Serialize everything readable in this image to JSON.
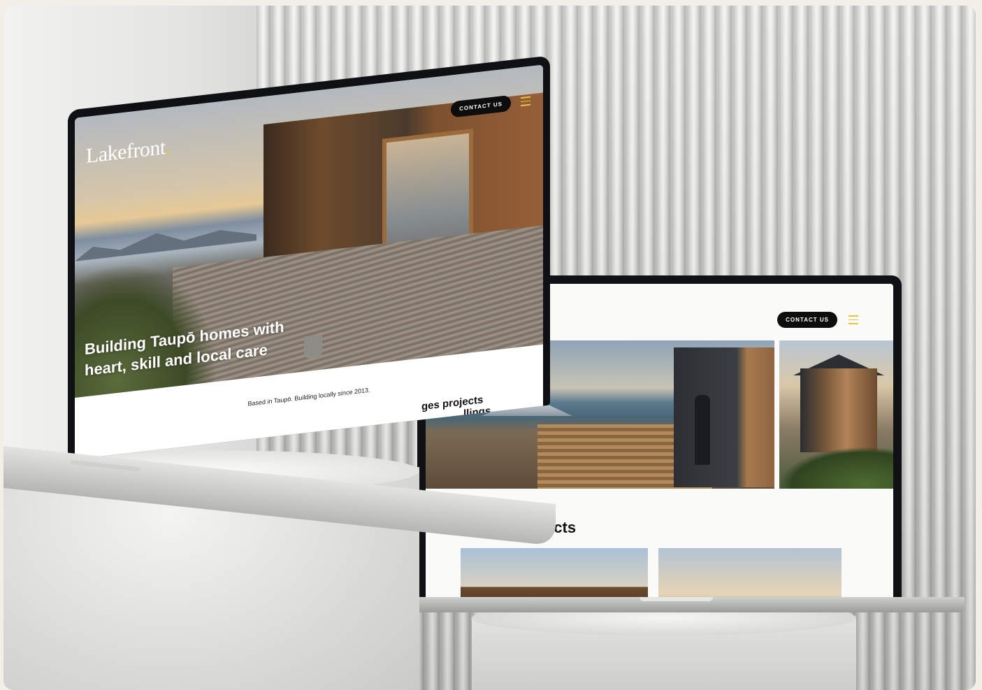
{
  "left_site": {
    "brand": "Lakefront",
    "brand_dot": ".",
    "contact_label": "CONTACT US",
    "hero_heading": "Building Taupō homes with heart, skill and local care",
    "tagline": "Based in Taupō. Building locally since 2013.",
    "peek_text_1": "ges projects",
    "peek_text_2": "llings"
  },
  "right_site": {
    "contact_label": "CONTACT US",
    "section_title": "Recent projects"
  },
  "colors": {
    "accent": "#e8c63b",
    "button_bg": "#0d0d0d"
  },
  "icons": [
    "hamburger-menu-icon"
  ]
}
